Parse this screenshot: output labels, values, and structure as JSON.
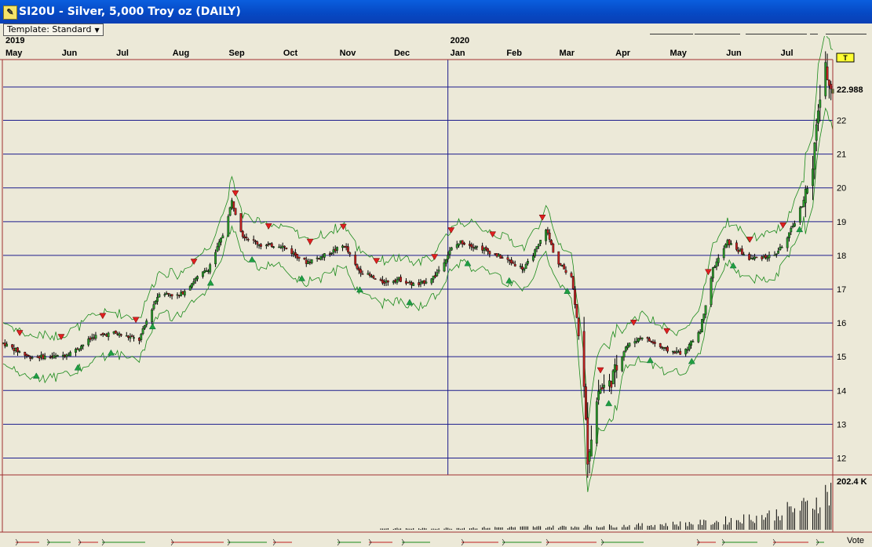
{
  "window": {
    "title": "SI20U - Silver, 5,000 Troy oz (DAILY)"
  },
  "toolbar": {
    "template_label": "Template: Standard"
  },
  "price_badge": "T",
  "volume_label": "202.4 K",
  "footer": {
    "vote_label": "Vote"
  },
  "colors": {
    "background": "#ece9d8",
    "grid": "#1c1c8c",
    "up_bar": "#2a9a2a",
    "down_bar": "#c02020",
    "envelope": "#1a8a1a",
    "frame": "#a03030"
  },
  "chart_data": {
    "type": "candlestick",
    "title": "SI20U - Silver, 5,000 Troy oz (DAILY)",
    "x_start": "2019-05-01",
    "x_end": "2020-07-31",
    "years": [
      {
        "label": "2019",
        "date": "2019-05-01"
      },
      {
        "label": "2020",
        "date": "2020-01-01"
      }
    ],
    "months": [
      {
        "label": "May",
        "date": "2019-05-01"
      },
      {
        "label": "Jun",
        "date": "2019-06-01"
      },
      {
        "label": "Jul",
        "date": "2019-07-01"
      },
      {
        "label": "Aug",
        "date": "2019-08-01"
      },
      {
        "label": "Sep",
        "date": "2019-09-01"
      },
      {
        "label": "Oct",
        "date": "2019-10-01"
      },
      {
        "label": "Nov",
        "date": "2019-11-01"
      },
      {
        "label": "Dec",
        "date": "2019-12-01"
      },
      {
        "label": "Jan",
        "date": "2020-01-01"
      },
      {
        "label": "Feb",
        "date": "2020-02-01"
      },
      {
        "label": "Mar",
        "date": "2020-03-01"
      },
      {
        "label": "Apr",
        "date": "2020-04-01"
      },
      {
        "label": "May",
        "date": "2020-05-01"
      },
      {
        "label": "Jun",
        "date": "2020-06-01"
      },
      {
        "label": "Jul",
        "date": "2020-07-01"
      }
    ],
    "y_ticks": [
      12,
      13,
      14,
      15,
      16,
      17,
      18,
      19,
      20,
      21,
      22
    ],
    "last_price": "22.988",
    "ylim": [
      11.5,
      23.8
    ],
    "grid": true,
    "anchors": [
      [
        "2019-05-01",
        15.4
      ],
      [
        "2019-05-15",
        15.0
      ],
      [
        "2019-06-01",
        15.0
      ],
      [
        "2019-06-10",
        15.2
      ],
      [
        "2019-06-20",
        15.6
      ],
      [
        "2019-07-01",
        15.7
      ],
      [
        "2019-07-15",
        15.5
      ],
      [
        "2019-07-20",
        16.2
      ],
      [
        "2019-07-26",
        16.9
      ],
      [
        "2019-08-06",
        16.8
      ],
      [
        "2019-08-15",
        17.3
      ],
      [
        "2019-08-22",
        17.6
      ],
      [
        "2019-08-30",
        18.6
      ],
      [
        "2019-09-04",
        19.6
      ],
      [
        "2019-09-10",
        18.6
      ],
      [
        "2019-09-20",
        18.3
      ],
      [
        "2019-10-01",
        18.3
      ],
      [
        "2019-10-15",
        17.8
      ],
      [
        "2019-10-25",
        18.0
      ],
      [
        "2019-11-05",
        18.3
      ],
      [
        "2019-11-12",
        17.6
      ],
      [
        "2019-11-25",
        17.2
      ],
      [
        "2019-12-05",
        17.3
      ],
      [
        "2019-12-15",
        17.1
      ],
      [
        "2019-12-25",
        17.4
      ],
      [
        "2020-01-03",
        18.2
      ],
      [
        "2020-01-08",
        18.4
      ],
      [
        "2020-01-20",
        18.2
      ],
      [
        "2020-02-01",
        17.9
      ],
      [
        "2020-02-12",
        17.6
      ],
      [
        "2020-02-20",
        18.3
      ],
      [
        "2020-02-24",
        18.8
      ],
      [
        "2020-03-01",
        17.8
      ],
      [
        "2020-03-09",
        17.4
      ],
      [
        "2020-03-12",
        16.2
      ],
      [
        "2020-03-16",
        14.0
      ],
      [
        "2020-03-18",
        12.0
      ],
      [
        "2020-03-24",
        14.0
      ],
      [
        "2020-03-30",
        14.2
      ],
      [
        "2020-04-08",
        15.3
      ],
      [
        "2020-04-17",
        15.6
      ],
      [
        "2020-04-30",
        15.2
      ],
      [
        "2020-05-10",
        15.1
      ],
      [
        "2020-05-19",
        15.8
      ],
      [
        "2020-05-26",
        17.6
      ],
      [
        "2020-06-03",
        18.4
      ],
      [
        "2020-06-15",
        17.9
      ],
      [
        "2020-06-29",
        18.0
      ],
      [
        "2020-07-06",
        18.5
      ],
      [
        "2020-07-14",
        19.5
      ],
      [
        "2020-07-20",
        20.5
      ],
      [
        "2020-07-23",
        22.4
      ],
      [
        "2020-07-27",
        23.5
      ],
      [
        "2020-07-31",
        22.9
      ]
    ],
    "volume_pattern": [
      [
        0.05,
        0.08
      ],
      [
        0.5,
        0.03
      ],
      [
        0.75,
        0.1
      ],
      [
        0.85,
        0.18
      ],
      [
        0.92,
        0.35
      ],
      [
        0.97,
        0.6
      ],
      [
        1.0,
        1.0
      ]
    ],
    "down_markers": [
      0.02,
      0.07,
      0.12,
      0.16,
      0.23,
      0.28,
      0.32,
      0.37,
      0.41,
      0.45,
      0.52,
      0.54,
      0.59,
      0.65,
      0.72,
      0.76,
      0.8,
      0.85,
      0.9,
      0.94
    ],
    "up_markers": [
      0.04,
      0.09,
      0.13,
      0.18,
      0.25,
      0.3,
      0.36,
      0.43,
      0.49,
      0.56,
      0.61,
      0.68,
      0.73,
      0.78,
      0.83,
      0.88,
      0.96
    ]
  }
}
